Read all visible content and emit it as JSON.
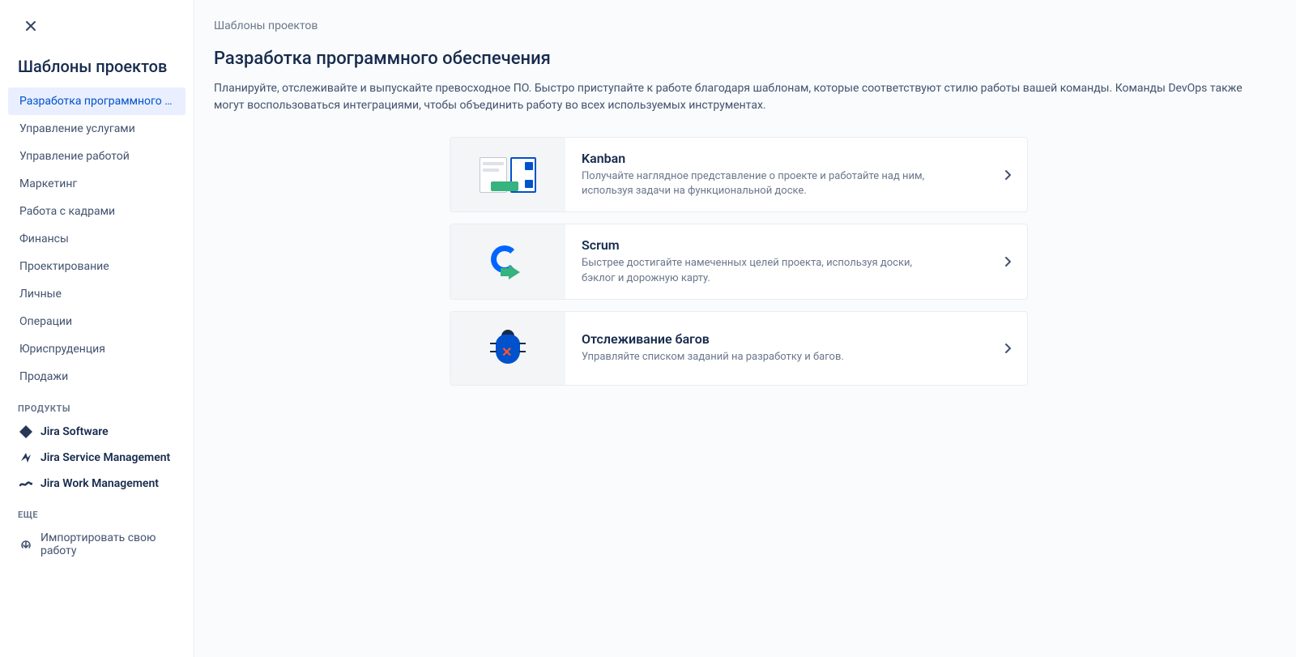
{
  "sidebar": {
    "title": "Шаблоны проектов",
    "categories": [
      {
        "label": "Разработка программного обеспечения",
        "active": true
      },
      {
        "label": "Управление услугами",
        "active": false
      },
      {
        "label": "Управление работой",
        "active": false
      },
      {
        "label": "Маркетинг",
        "active": false
      },
      {
        "label": "Работа с кадрами",
        "active": false
      },
      {
        "label": "Финансы",
        "active": false
      },
      {
        "label": "Проектирование",
        "active": false
      },
      {
        "label": "Личные",
        "active": false
      },
      {
        "label": "Операции",
        "active": false
      },
      {
        "label": "Юриспруденция",
        "active": false
      },
      {
        "label": "Продажи",
        "active": false
      }
    ],
    "products_header": "ПРОДУКТЫ",
    "products": [
      {
        "label": "Jira Software",
        "icon": "jira-software-icon"
      },
      {
        "label": "Jira Service Management",
        "icon": "jira-service-icon"
      },
      {
        "label": "Jira Work Management",
        "icon": "jira-work-icon"
      }
    ],
    "more_header": "ЕЩЕ",
    "more": [
      {
        "label": "Импортировать свою работу",
        "icon": "import-icon"
      }
    ]
  },
  "main": {
    "breadcrumb": "Шаблоны проектов",
    "title": "Разработка программного обеспечения",
    "description": "Планируйте, отслеживайте и выпускайте превосходное ПО. Быстро приступайте к работе благодаря шаблонам, которые соответствуют стилю работы вашей команды. Команды DevOps также могут воспользоваться интеграциями, чтобы объединить работу во всех используемых инструментах.",
    "templates": [
      {
        "key": "kanban",
        "title": "Kanban",
        "desc": "Получайте наглядное представление о проекте и работайте над ним, используя задачи на функциональной доске."
      },
      {
        "key": "scrum",
        "title": "Scrum",
        "desc": "Быстрее достигайте намеченных целей проекта, используя доски, бэклог и дорожную карту."
      },
      {
        "key": "bug",
        "title": "Отслеживание багов",
        "desc": "Управляйте списком заданий на разработку и багов."
      }
    ]
  }
}
